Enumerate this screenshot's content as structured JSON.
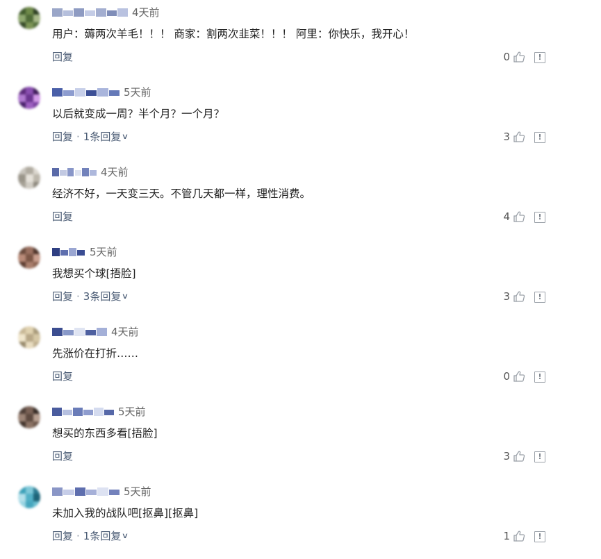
{
  "comments": [
    {
      "time": "4天前",
      "text": "用户：薅两次羊毛！！！ 商家：割两次韭菜！！！ 阿里：你快乐，我开心！",
      "reply": "回复",
      "replies": "",
      "likes": "0",
      "avatar_colors": [
        "#3f5a2c",
        "#6f8a4a",
        "#2c3e22",
        "#8fa870",
        "#4f6b38",
        "#a8b98a",
        "#364a28",
        "#7c9456",
        "#55703d"
      ],
      "name_colors": [
        "#9aa6c8",
        "#b5bfdc",
        "#8e9bc2",
        "#c4cce6",
        "#a3aed0",
        "#7f8db8",
        "#b9c2e0"
      ]
    },
    {
      "time": "5天前",
      "text": "以后就变成一周？半个月？一个月？",
      "reply": "回复",
      "replies": "1条回复",
      "likes": "3",
      "avatar_colors": [
        "#5b2a7a",
        "#8a4fb0",
        "#3e1b58",
        "#b07ad0",
        "#6b3590",
        "#d39be8",
        "#48206a",
        "#9d60c0",
        "#7a40a0"
      ],
      "name_colors": [
        "#4a5fa8",
        "#8d9ccf",
        "#c7cfe9",
        "#3c4f96",
        "#a9b5dc",
        "#6579b8"
      ]
    },
    {
      "time": "4天前",
      "text": "经济不好，一天变三天。不管几天都一样，理性消费。",
      "reply": "回复",
      "replies": "",
      "likes": "4",
      "avatar_colors": [
        "#c8c4bc",
        "#b0aba0",
        "#dcd8d0",
        "#9a958a",
        "#e6e2da",
        "#bcb7ac",
        "#a6a196",
        "#d0ccc4",
        "#8e897e"
      ],
      "name_colors": [
        "#5a6aa8",
        "#c2c9e2",
        "#8896c8",
        "#dde2f0",
        "#7282bb",
        "#aeb8dc"
      ]
    },
    {
      "time": "5天前",
      "text": "我想买个球[捂脸]",
      "reply": "回复",
      "replies": "3条回复",
      "likes": "3",
      "avatar_colors": [
        "#6a4a3c",
        "#9a7060",
        "#4e342a",
        "#b88a78",
        "#7c5646",
        "#caa090",
        "#5e3e32",
        "#a87e6c",
        "#8c6452"
      ],
      "name_colors": [
        "#2f3f82",
        "#5e6fae",
        "#9aa6d2",
        "#3a4c92"
      ]
    },
    {
      "time": "4天前",
      "text": "先涨价在打折……",
      "reply": "回复",
      "replies": "",
      "likes": "0",
      "avatar_colors": [
        "#c8b896",
        "#e0d2b0",
        "#a89a7a",
        "#f0e6cc",
        "#b8a888",
        "#d6c8a6",
        "#988a6c",
        "#e8dcc0",
        "#c0b090"
      ],
      "name_colors": [
        "#3c4e90",
        "#8898c8",
        "#dfe4f2",
        "#4e60a0",
        "#a4b0d8"
      ]
    },
    {
      "time": "5天前",
      "text": "想买的东西多看[捂脸]",
      "reply": "回复",
      "replies": "",
      "likes": "3",
      "avatar_colors": [
        "#4e3e36",
        "#7a6256",
        "#352a24",
        "#9c8476",
        "#5e4a40",
        "#b8a092",
        "#42342c",
        "#8a7264",
        "#6c564a"
      ],
      "name_colors": [
        "#4a5c9e",
        "#b6c0e0",
        "#6a7cb8",
        "#8e9cce",
        "#d4dbef",
        "#5668a8"
      ]
    },
    {
      "time": "5天前",
      "text": "未加入我的战队吧[抠鼻][抠鼻]",
      "reply": "回复",
      "replies": "1条回复",
      "likes": "1",
      "avatar_colors": [
        "#3ca0b8",
        "#80c8d8",
        "#2a7a90",
        "#b4e0ea",
        "#52b0c6",
        "#1e6478",
        "#98d4e2",
        "#46a6be",
        "#6abed0"
      ],
      "name_colors": [
        "#8a96c6",
        "#c6cde8",
        "#5e6eae",
        "#a6b0d8",
        "#dde2f2",
        "#7482bc"
      ]
    }
  ]
}
